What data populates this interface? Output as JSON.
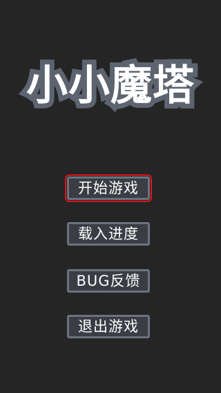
{
  "game": {
    "title": "小小魔塔"
  },
  "menu": {
    "selected_index": 0,
    "items": [
      {
        "label": "开始游戏"
      },
      {
        "label": "载入进度"
      },
      {
        "label": "BUG反馈"
      },
      {
        "label": "退出游戏"
      }
    ]
  },
  "colors": {
    "background": "#252526",
    "title_fill": "#ffffff",
    "title_outline": "#5d6470",
    "button_fill": "#3a3d43",
    "button_border": "#6c737f",
    "selection_outline": "#e0141b"
  }
}
